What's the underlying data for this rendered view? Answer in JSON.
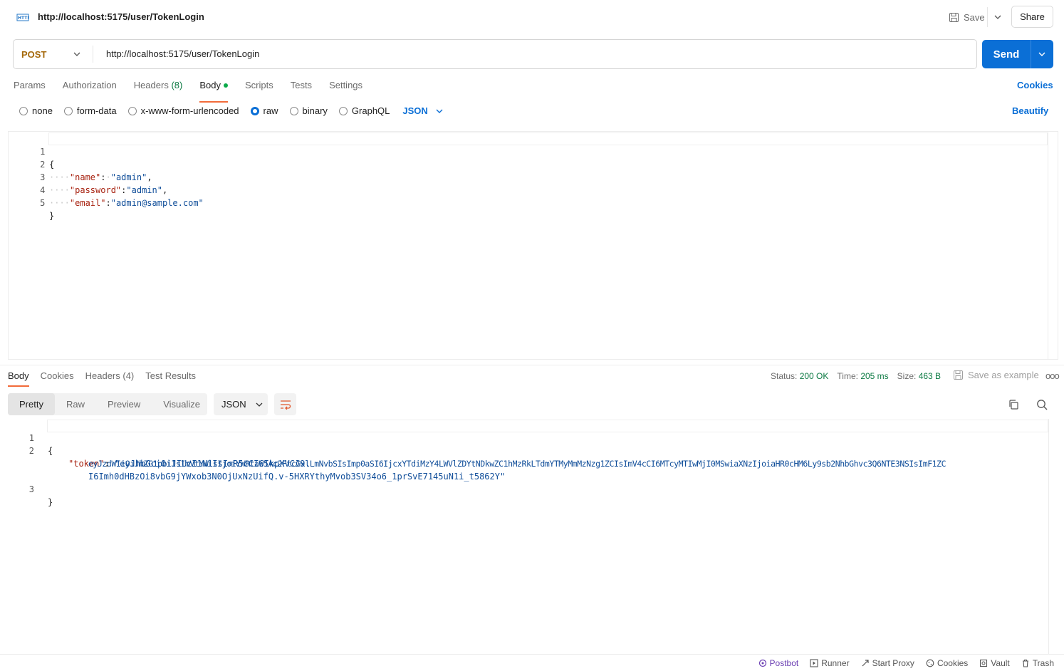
{
  "request": {
    "title": "http://localhost:5175/user/TokenLogin",
    "method": "POST",
    "url": "http://localhost:5175/user/TokenLogin",
    "save_label": "Save",
    "share_label": "Share",
    "send_label": "Send"
  },
  "request_tabs": [
    {
      "label": "Params"
    },
    {
      "label": "Authorization"
    },
    {
      "label": "Headers",
      "count": "(8)"
    },
    {
      "label": "Body"
    },
    {
      "label": "Scripts"
    },
    {
      "label": "Tests"
    },
    {
      "label": "Settings"
    }
  ],
  "cookies_label": "Cookies",
  "body_types": [
    "none",
    "form-data",
    "x-www-form-urlencoded",
    "raw",
    "binary",
    "GraphQL"
  ],
  "selected_body_type": "raw",
  "body_format": "JSON",
  "beautify_label": "Beautify",
  "request_body": {
    "line_numbers": [
      "1",
      "2",
      "3",
      "4",
      "5"
    ],
    "open_brace": "{",
    "close_brace": "}",
    "fields": [
      {
        "key": "\"name\"",
        "sep": ":",
        "value": "\"admin\"",
        "trail": ","
      },
      {
        "key": "\"password\"",
        "sep": ":",
        "value": "\"admin\"",
        "trail": ","
      },
      {
        "key": "\"email\"",
        "sep": ":",
        "value": "\"admin@sample.com\"",
        "trail": ""
      }
    ]
  },
  "response_tabs": [
    {
      "label": "Body"
    },
    {
      "label": "Cookies"
    },
    {
      "label": "Headers (4)"
    },
    {
      "label": "Test Results"
    }
  ],
  "response_meta": {
    "status_label": "Status:",
    "status": "200 OK",
    "time_label": "Time:",
    "time": "205 ms",
    "size_label": "Size:",
    "size": "463 B",
    "save_example": "Save as example"
  },
  "view_modes": [
    "Pretty",
    "Raw",
    "Preview",
    "Visualize"
  ],
  "response_format": "JSON",
  "response_body": {
    "line_numbers": [
      "1",
      "2",
      "3"
    ],
    "open_brace": "{",
    "close_brace": "}",
    "token_key": "\"token\"",
    "token_line1": "\"eyJhbGciOiJIUzI1NiIsInR5cCI6IkpXVCJ9.",
    "token_line2": "eyJzdWIiOiJhZG1pbiIsImVtYWlsIjoiYWRtaW5Ac2FtcGxlLmNvbSIsImp0aSI6IjcxYTdiMzY4LWVlZDYtNDkwZC1hMzRkLTdmYTMyMmMzNzg1ZCIsImV4cCI6MTcyMTIwMjI0MSwiaXNzIjoiaHR0cHM6Ly9sb2NhbGhvc3Q6NTE3NSIsImF1ZC",
    "token_line3": "I6Imh0dHBzOi8vbG9jYWxob3N0OjUxNzUifQ.v-5HXRYthyMvob3SV34o6_1prSvE7145uN1i_t5862Y\""
  },
  "footer": [
    "Postbot",
    "Runner",
    "Start Proxy",
    "Cookies",
    "Vault",
    "Trash"
  ],
  "colors": {
    "accent": "#0b6fd6",
    "tab_indicator": "#f26b3a",
    "method": "#a5690c",
    "success": "#0c7a43"
  }
}
